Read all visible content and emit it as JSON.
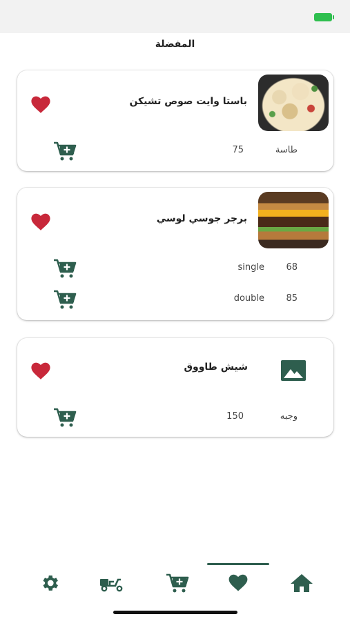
{
  "header": {
    "title": "المفضلة"
  },
  "favorites": [
    {
      "name": "باستا وايت صوص تشيكن",
      "image": "pasta-photo",
      "variants": [
        {
          "size": "طاسة",
          "price": "75"
        }
      ]
    },
    {
      "name": "برجر جوسي لوسي",
      "image": "burger-photo",
      "variants": [
        {
          "size": "single",
          "price": "68"
        },
        {
          "size": "double",
          "price": "85"
        }
      ]
    },
    {
      "name": "شيش طاووق",
      "image": "image-placeholder-icon",
      "variants": [
        {
          "size": "وجبه",
          "price": "150"
        }
      ]
    }
  ],
  "bottom_nav": {
    "items": [
      "settings-icon",
      "delivery-scooter-icon",
      "cart-add-icon",
      "heart-icon",
      "home-icon"
    ],
    "active": "heart-icon"
  },
  "colors": {
    "primary": "#2e5e4e",
    "heart": "#c8283a",
    "status_battery": "#2fbf4f"
  }
}
